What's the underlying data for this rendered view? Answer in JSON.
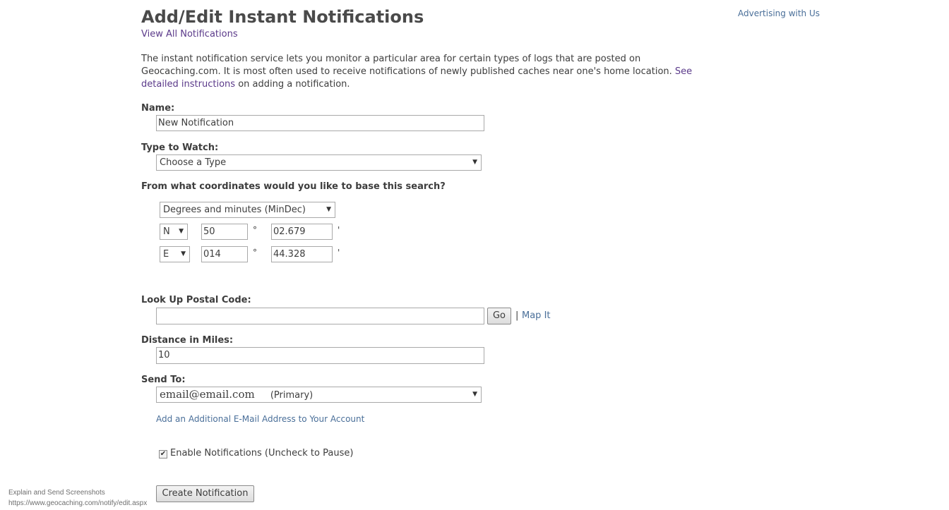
{
  "header": {
    "advertising_link": "Advertising with Us"
  },
  "page": {
    "title": "Add/Edit Instant Notifications",
    "view_all_link": "View All Notifications",
    "intro_text": "The instant notification service lets you monitor a particular area for certain types of logs that are posted on Geocaching.com. It is most often used to receive notifications of newly published caches near one's home location.",
    "intro_link": "See detailed instructions",
    "intro_suffix": "on adding a notification."
  },
  "form": {
    "name_label": "Name:",
    "name_value": "New Notification",
    "type_label": "Type to Watch:",
    "type_value": "Choose a Type",
    "coords_label": "From what coordinates would you like to base this search?",
    "coord_format": "Degrees and minutes (MinDec)",
    "lat_dir": "N",
    "lat_deg": "50",
    "lat_min": "02.679",
    "lon_dir": "E",
    "lon_deg": "014",
    "lon_min": "44.328",
    "degree_symbol": "°",
    "minute_symbol": "'",
    "postal_label": "Look Up Postal Code:",
    "postal_value": "",
    "go_button": "Go",
    "separator": "|",
    "map_it_link": "Map It",
    "distance_label": "Distance in Miles:",
    "distance_value": "10",
    "send_to_label": "Send To:",
    "send_to_email": "email@email.com",
    "send_to_tag": "(Primary)",
    "add_email_link": "Add an Additional E-Mail Address to Your Account",
    "enable_checked": true,
    "enable_label": "Enable Notifications (Uncheck to Pause)",
    "create_button": "Create Notification"
  },
  "status_bar": {
    "line1": "Explain and Send Screenshots",
    "line2": "https://www.geocaching.com/notify/edit.aspx"
  }
}
